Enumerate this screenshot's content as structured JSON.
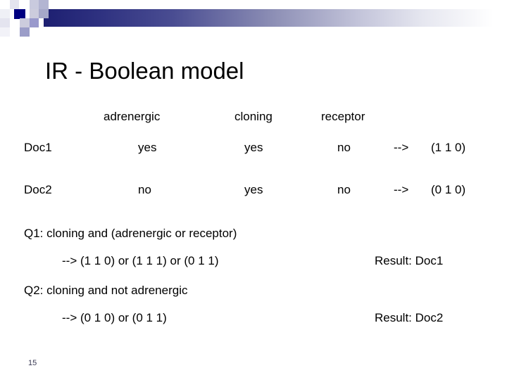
{
  "slide": {
    "title": "IR - Boolean model",
    "number": "15"
  },
  "decoration": {
    "bar_dark_color": "#1d1f71",
    "square_navy_color": "#000080",
    "square_mid_color": "#9999cc",
    "square_light_color": "#ccccdd"
  },
  "matrix": {
    "corner_label": "",
    "terms": [
      "adrenergic",
      "cloning",
      "receptor"
    ],
    "rows": [
      {
        "doc": "Doc1",
        "values": [
          "yes",
          "yes",
          "no"
        ],
        "arrow": "-->",
        "vector": "(1 1 0)"
      },
      {
        "doc": "Doc2",
        "values": [
          "no",
          "yes",
          "no"
        ],
        "arrow": "-->",
        "vector": "(0 1 0)"
      }
    ]
  },
  "queries": [
    {
      "query": "Q1: cloning and (adrenergic or receptor)",
      "expansion": "--> (1 1 0) or (1 1 1) or (0 1 1)",
      "result": "Result: Doc1"
    },
    {
      "query": "Q2: cloning and not adrenergic",
      "expansion": "--> (0 1 0) or (0 1 1)",
      "result": "Result: Doc2"
    }
  ]
}
